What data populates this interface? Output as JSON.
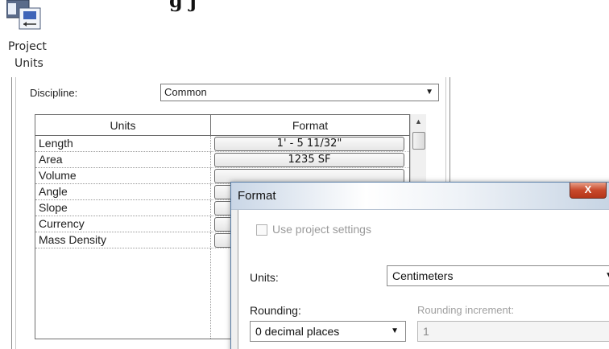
{
  "heading": "g  j",
  "ribbon": {
    "tool_line1": "Project",
    "tool_line2": "Units",
    "icon": "project-units-icon"
  },
  "project_units": {
    "discipline_label": "Discipline:",
    "discipline_value": "Common",
    "columns": {
      "units": "Units",
      "format": "Format"
    },
    "rows": [
      {
        "unit": "Length",
        "format": "1' - 5 11/32\""
      },
      {
        "unit": "Area",
        "format": "1235 SF"
      },
      {
        "unit": "Volume",
        "format": ""
      },
      {
        "unit": "Angle",
        "format": ""
      },
      {
        "unit": "Slope",
        "format": ""
      },
      {
        "unit": "Currency",
        "format": ""
      },
      {
        "unit": "Mass Density",
        "format": ""
      }
    ]
  },
  "format_dialog": {
    "title": "Format",
    "close_glyph": "X",
    "use_project_settings_label": "Use project settings",
    "units_label": "Units:",
    "units_value": "Centimeters",
    "rounding_label": "Rounding:",
    "rounding_value": "0 decimal places",
    "rounding_increment_label": "Rounding increment:",
    "rounding_increment_value": "1"
  },
  "colors": {
    "close_button": "#c8492b",
    "title_gradient": "#c9d6e6"
  }
}
